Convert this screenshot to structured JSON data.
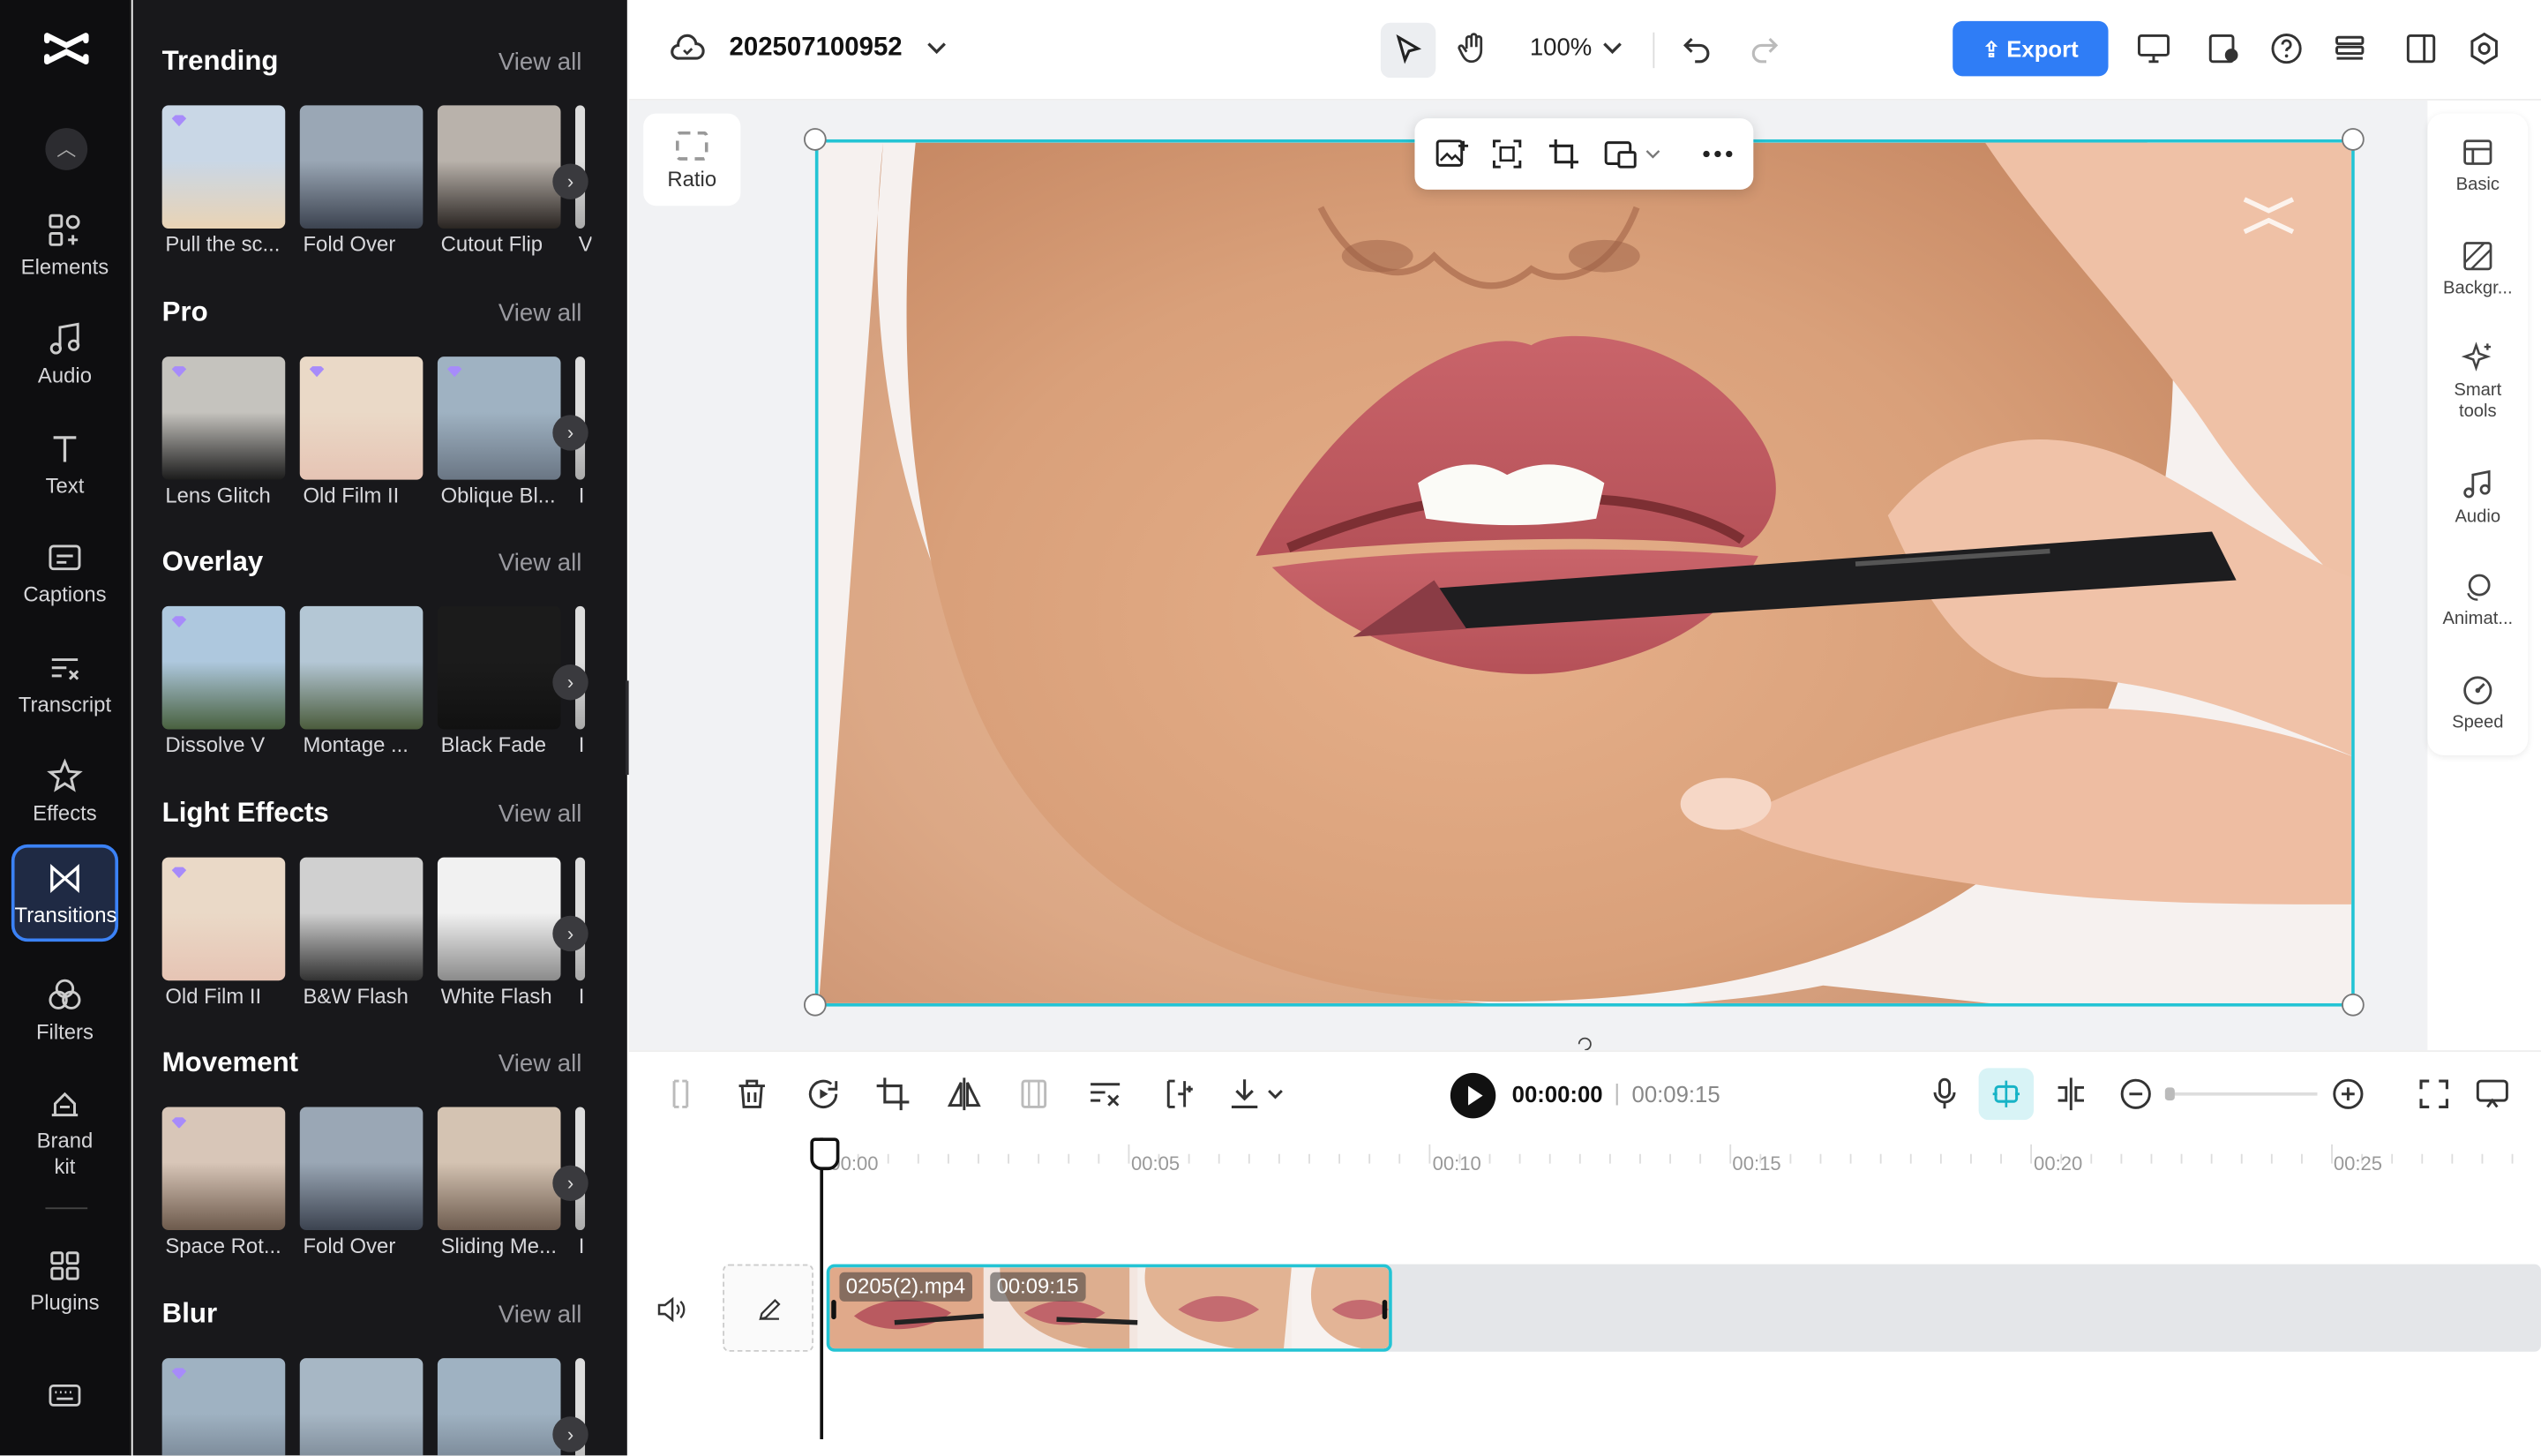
{
  "left_rail": {
    "items": [
      {
        "label": "Elements",
        "icon": "elements-icon"
      },
      {
        "label": "Audio",
        "icon": "audio-icon"
      },
      {
        "label": "Text",
        "icon": "text-icon"
      },
      {
        "label": "Captions",
        "icon": "captions-icon"
      },
      {
        "label": "Transcript",
        "icon": "transcript-icon"
      },
      {
        "label": "Effects",
        "icon": "effects-icon"
      },
      {
        "label": "Transitions",
        "icon": "transitions-icon",
        "active": true
      },
      {
        "label": "Filters",
        "icon": "filters-icon"
      },
      {
        "label": "Brand kit",
        "icon": "brand-kit-icon"
      },
      {
        "label": "Plugins",
        "icon": "plugins-icon"
      }
    ]
  },
  "panel": {
    "view_all": "View all",
    "sections": [
      {
        "title": "Trending",
        "items": [
          "Pull the sc...",
          "Fold Over",
          "Cutout Flip",
          "V"
        ]
      },
      {
        "title": "Pro",
        "items": [
          "Lens Glitch",
          "Old Film II",
          "Oblique Bl...",
          "I"
        ]
      },
      {
        "title": "Overlay",
        "items": [
          "Dissolve V",
          "Montage ...",
          "Black Fade",
          "I"
        ]
      },
      {
        "title": "Light Effects",
        "items": [
          "Old Film II",
          "B&W Flash",
          "White Flash",
          "I"
        ]
      },
      {
        "title": "Movement",
        "items": [
          "Space Rot...",
          "Fold Over",
          "Sliding Me...",
          "I"
        ]
      },
      {
        "title": "Blur",
        "items": [
          "",
          "",
          "",
          ""
        ]
      }
    ]
  },
  "topbar": {
    "project_name": "202507100952",
    "zoom": "100%",
    "export_label": "Export"
  },
  "canvas": {
    "ratio_label": "Ratio"
  },
  "right_rail": {
    "items": [
      {
        "label": "Basic",
        "icon": "basic-icon"
      },
      {
        "label": "Backgr...",
        "icon": "background-icon"
      },
      {
        "label": "Smart tools",
        "icon": "smart-tools-icon"
      },
      {
        "label": "Audio",
        "icon": "audio-icon"
      },
      {
        "label": "Animat...",
        "icon": "animation-icon"
      },
      {
        "label": "Speed",
        "icon": "speed-icon"
      }
    ]
  },
  "playback": {
    "current_time": "00:00:00",
    "separator": "|",
    "total_time": "00:09:15"
  },
  "timeline": {
    "ruler": [
      "00:00",
      "00:05",
      "00:10",
      "00:15",
      "00:20",
      "00:25"
    ],
    "clip": {
      "name": "0205(2).mp4",
      "duration": "00:09:15"
    }
  },
  "colors": {
    "accent": "#2f7df6",
    "selection": "#23c4d4",
    "rail_bg": "#0e0e10",
    "panel_bg": "#18181b"
  }
}
